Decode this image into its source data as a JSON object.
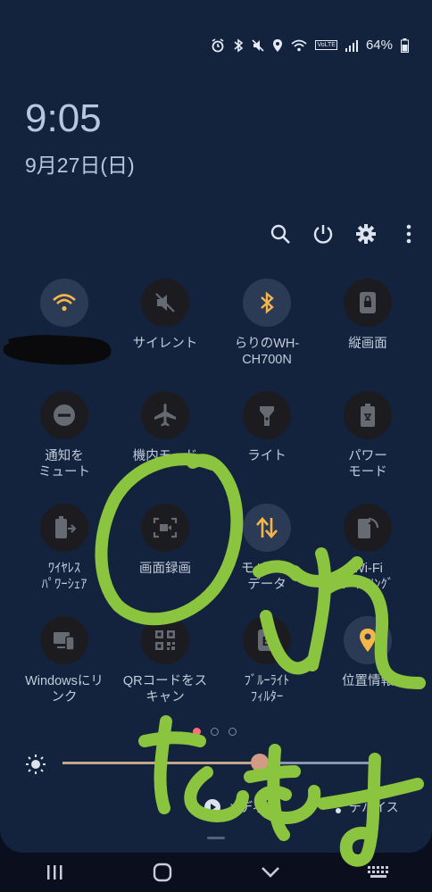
{
  "status_bar": {
    "battery_text": "64%",
    "volte_text": "VoLTE"
  },
  "clock": {
    "time": "9:05",
    "date": "9月27日(日)"
  },
  "toolbar": {
    "icons": [
      "search-icon",
      "power-icon",
      "settings-icon",
      "more-icon"
    ]
  },
  "tiles": [
    {
      "label": "",
      "icon": "wifi-icon",
      "on": true
    },
    {
      "label": "サイレント",
      "icon": "sound-off-icon",
      "on": false
    },
    {
      "label": "らりのWH-\nCH700N",
      "icon": "bluetooth-icon",
      "on": true
    },
    {
      "label": "縦画面",
      "icon": "portrait-lock-icon",
      "on": false
    },
    {
      "label": "通知を\nミュート",
      "icon": "do-not-disturb-icon",
      "on": false
    },
    {
      "label": "機内モード",
      "icon": "airplane-icon",
      "on": false
    },
    {
      "label": "ライト",
      "icon": "flashlight-icon",
      "on": false
    },
    {
      "label": "パワー\nモード",
      "icon": "power-mode-icon",
      "on": false
    },
    {
      "label": "ﾜｲﾔﾚｽ\nﾊﾟﾜｰｼｪｱ",
      "icon": "wireless-powershare-icon",
      "on": false
    },
    {
      "label": "画面録画",
      "icon": "screen-recorder-icon",
      "on": false
    },
    {
      "label": "モバイル\nデータ",
      "icon": "mobile-data-icon",
      "on": true
    },
    {
      "label": "Wi-Fi\nﾃﾞｻﾞﾘﾝｸﾞ",
      "icon": "hotspot-icon",
      "on": false
    },
    {
      "label": "Windowsにリ\nンク",
      "icon": "link-to-windows-icon",
      "on": false
    },
    {
      "label": "QRコードをス\nキャン",
      "icon": "qr-scan-icon",
      "on": false
    },
    {
      "label": "ﾌﾞﾙｰﾗｲﾄ\nﾌｨﾙﾀｰ",
      "icon": "blue-light-filter-icon",
      "on": false
    },
    {
      "label": "位置情報",
      "icon": "location-icon",
      "on": true
    }
  ],
  "pager": {
    "count": 3,
    "active_index": 0
  },
  "brightness": {
    "level": 0.64
  },
  "bottom": {
    "media_label": "メディア",
    "devices_label": "デバイス"
  },
  "nav": {
    "icons": [
      "recents-icon",
      "home-icon",
      "back-icon",
      "keyboard-icon"
    ]
  },
  "colors": {
    "panel": "#14233d",
    "accent_on": "#f4b64a",
    "annotation": "#8bc43f",
    "dot_active": "#ff6f7a"
  }
}
